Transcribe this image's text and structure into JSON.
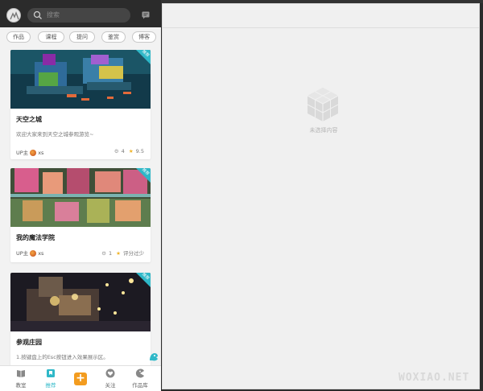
{
  "header": {
    "search_placeholder": "搜索",
    "avatar_icon": "avatar-icon",
    "message_icon": "message-icon"
  },
  "tags": [
    "作品",
    "课程",
    "提问",
    "鉴赏",
    "博客"
  ],
  "cards": [
    {
      "title": "天空之城",
      "desc": "欢迎大家来到天空之城参观游览~",
      "up_label": "UP主",
      "up_name": "xs",
      "comments": "4",
      "rating": "9.5",
      "badge": "推荐"
    },
    {
      "title": "我的魔法学院",
      "desc": "",
      "up_label": "UP主",
      "up_name": "xs",
      "comments": "1",
      "rating": "评分过少",
      "badge": "推荐"
    },
    {
      "title": "参观庄园",
      "desc": "1.按键盘上的Esc按钮进入效果展示区。",
      "badge": "推荐"
    }
  ],
  "bottom_nav": [
    {
      "label": "教室",
      "icon": "book-icon"
    },
    {
      "label": "推荐",
      "icon": "bookmark-icon",
      "active": true
    },
    {
      "label": "",
      "icon": "plus-icon"
    },
    {
      "label": "关注",
      "icon": "heart-icon"
    },
    {
      "label": "作品库",
      "icon": "pacman-icon"
    }
  ],
  "right_panel": {
    "empty_text": "未选择内容",
    "empty_icon": "cube-icon"
  },
  "watermark": "WOXIAO.NET",
  "colors": {
    "accent": "#2fb8c8",
    "add_button": "#f39c1f",
    "dark_header": "#2b2b2b"
  }
}
